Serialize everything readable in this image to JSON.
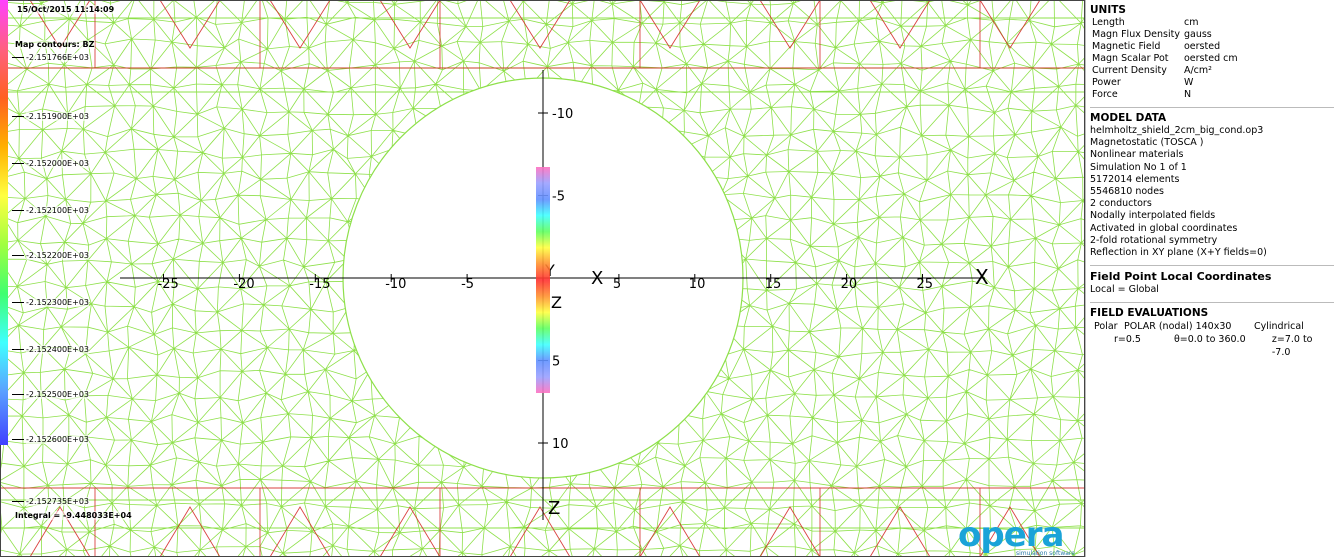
{
  "viewport": {
    "timestamp": "15/Oct/2015 11:14:09",
    "map_title": "Map contours: BZ",
    "integral": "Integral = -9.448033E+04",
    "legend_values": [
      "-2.151766E+03",
      "-2.151900E+03",
      "-2.152000E+03",
      "-2.152100E+03",
      "-2.152200E+03",
      "-2.152300E+03",
      "-2.152400E+03",
      "-2.152500E+03",
      "-2.152600E+03",
      "-2.152735E+03"
    ],
    "x_ticks": [
      -25,
      -20,
      -15,
      -10,
      -5,
      5,
      10,
      15,
      20,
      25
    ],
    "y_ticks": [
      -10,
      -5,
      5,
      10
    ],
    "axis_labels": {
      "x": "X",
      "y": "Y",
      "z": "Z"
    },
    "colors": {
      "mesh": "#8ee04a",
      "conductor": "#d42020",
      "axis": "#000000"
    }
  },
  "logo": {
    "word": "opera",
    "sub": "simulation software"
  },
  "panel": {
    "units": {
      "title": "UNITS",
      "rows": [
        {
          "name": "Length",
          "unit": "cm"
        },
        {
          "name": "Magn Flux Density",
          "unit": "gauss"
        },
        {
          "name": "Magnetic Field",
          "unit": "oersted"
        },
        {
          "name": "Magn Scalar Pot",
          "unit": "oersted cm"
        },
        {
          "name": "Current Density",
          "unit": "A/cm²"
        },
        {
          "name": "Power",
          "unit": "W"
        },
        {
          "name": "Force",
          "unit": "N"
        }
      ]
    },
    "model": {
      "title": "MODEL DATA",
      "lines": [
        "helmholtz_shield_2cm_big_cond.op3",
        "Magnetostatic (TOSCA )",
        "Nonlinear materials",
        "Simulation No 1 of 1",
        "5172014 elements",
        "5546810 nodes",
        "2 conductors",
        "Nodally interpolated fields",
        "Activated in global coordinates",
        "2-fold rotational symmetry",
        "Reflection in XY plane (X+Y fields=0)"
      ]
    },
    "local": {
      "title": "Field Point Local Coordinates",
      "line": "Local = Global"
    },
    "evaluations": {
      "title": "FIELD EVALUATIONS",
      "row1": [
        "Polar",
        "POLAR (nodal) 140x30",
        "Cylindrical"
      ],
      "row2": [
        "r=0.5",
        "θ=0.0 to 360.0",
        "z=7.0 to -7.0"
      ]
    }
  }
}
